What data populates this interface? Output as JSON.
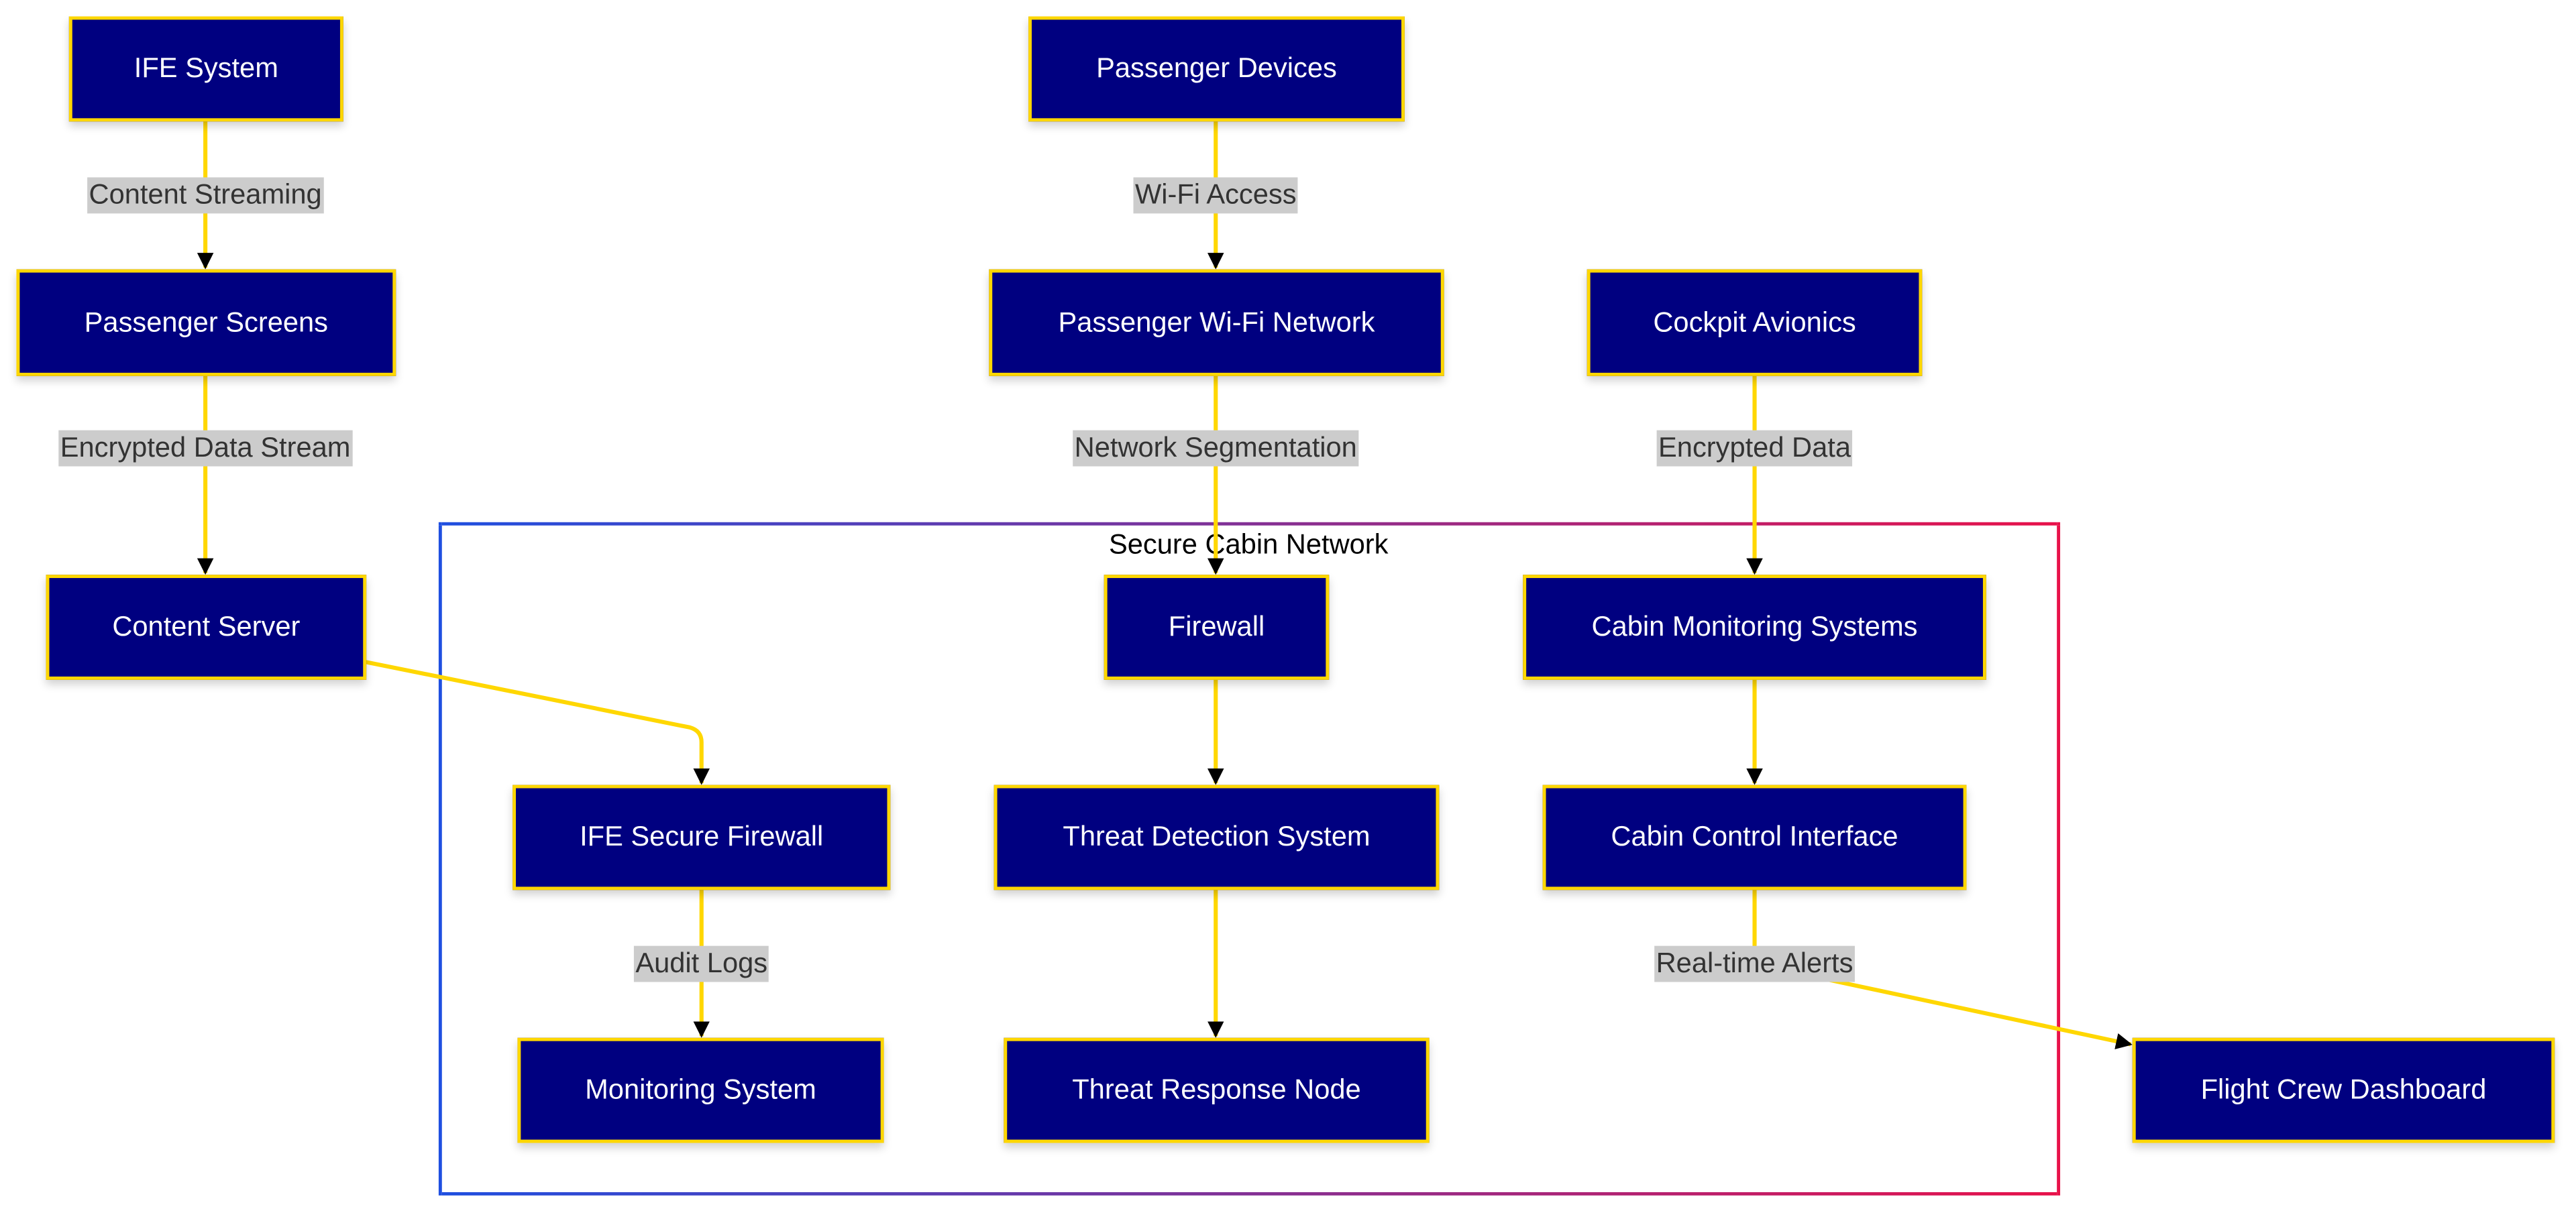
{
  "cluster": {
    "title": "Secure Cabin Network"
  },
  "colors": {
    "node_fill": "#000080",
    "node_border": "#FFD700",
    "edge": "#FFD700",
    "edge_label_bg": "#cccccc",
    "cluster_gradient_start": "#1f4fe0",
    "cluster_gradient_end": "#e8124a"
  },
  "nodes": {
    "ife_system": "IFE System",
    "passenger_screens": "Passenger Screens",
    "content_server": "Content Server",
    "passenger_devices": "Passenger Devices",
    "passenger_wifi": "Passenger Wi-Fi Network",
    "cockpit_avionics": "Cockpit Avionics",
    "firewall": "Firewall",
    "cabin_monitoring": "Cabin Monitoring Systems",
    "ife_secure_firewall": "IFE Secure Firewall",
    "threat_detection": "Threat Detection System",
    "cabin_control": "Cabin Control Interface",
    "monitoring_system": "Monitoring System",
    "threat_response": "Threat Response Node",
    "flight_crew_dashboard": "Flight Crew Dashboard"
  },
  "edges": [
    {
      "from": "IFE System",
      "to": "Passenger Screens",
      "label": "Content Streaming"
    },
    {
      "from": "Passenger Screens",
      "to": "Content Server",
      "label": "Encrypted Data Stream"
    },
    {
      "from": "Passenger Devices",
      "to": "Passenger Wi-Fi Network",
      "label": "Wi-Fi Access"
    },
    {
      "from": "Passenger Wi-Fi Network",
      "to": "Firewall",
      "label": "Network Segmentation"
    },
    {
      "from": "Cockpit Avionics",
      "to": "Cabin Monitoring Systems",
      "label": "Encrypted Data"
    },
    {
      "from": "Content Server",
      "to": "IFE Secure Firewall",
      "label": ""
    },
    {
      "from": "Firewall",
      "to": "Threat Detection System",
      "label": ""
    },
    {
      "from": "Cabin Monitoring Systems",
      "to": "Cabin Control Interface",
      "label": ""
    },
    {
      "from": "IFE Secure Firewall",
      "to": "Monitoring System",
      "label": "Audit Logs"
    },
    {
      "from": "Threat Detection System",
      "to": "Threat Response Node",
      "label": ""
    },
    {
      "from": "Cabin Control Interface",
      "to": "Flight Crew Dashboard",
      "label": "Real-time Alerts"
    }
  ]
}
